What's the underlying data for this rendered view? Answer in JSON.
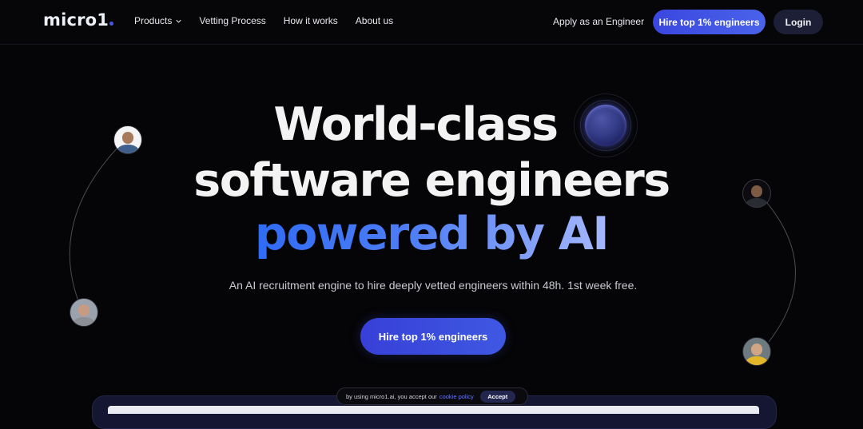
{
  "nav": {
    "logo": "micro1",
    "links": [
      {
        "label": "Products",
        "has_dropdown": true
      },
      {
        "label": "Vetting Process"
      },
      {
        "label": "How it works"
      },
      {
        "label": "About us"
      }
    ],
    "apply_label": "Apply as an Engineer",
    "hire_label": "Hire top 1% engineers",
    "login_label": "Login"
  },
  "hero": {
    "line1": "World-class",
    "line2": "software engineers",
    "line3": "powered by AI",
    "subtitle": "An AI recruitment engine to hire deeply vetted engineers within 48h. 1st week free.",
    "cta_label": "Hire top 1% engineers"
  },
  "avatars": [
    {
      "name": "engineer-avatar-top-left"
    },
    {
      "name": "engineer-avatar-bottom-left"
    },
    {
      "name": "engineer-avatar-top-right"
    },
    {
      "name": "engineer-avatar-bottom-right"
    }
  ],
  "cookie": {
    "text": "by using micro1.ai, you accept our",
    "link": "cookie policy",
    "accept_label": "Accept"
  },
  "colors": {
    "accent": "#3a46e0",
    "accent_light": "#4a63ea",
    "gradient_start": "#2f6bf5",
    "gradient_end": "#a6b8fb",
    "background": "#050507",
    "login_bg": "#1c1f36"
  }
}
